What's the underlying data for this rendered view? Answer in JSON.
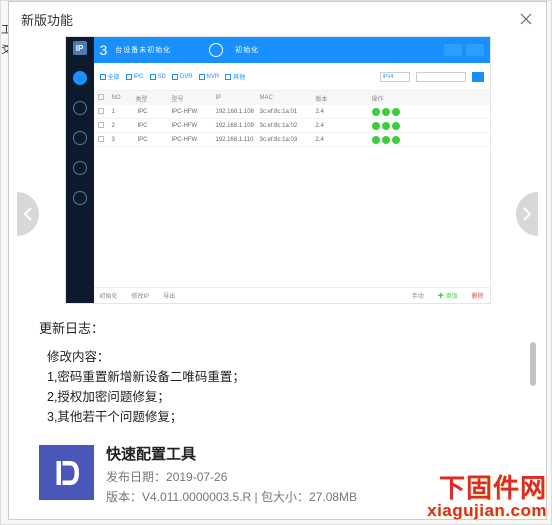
{
  "left_edge": {
    "char1": "工",
    "char2": "爻"
  },
  "header": {
    "title": "新版功能",
    "close_tooltip": "关闭"
  },
  "screenshot": {
    "big_number": "3",
    "top_text": "台设备未初始化",
    "top_link": "初始化",
    "filters": [
      "全部",
      "IPC",
      "SD",
      "DVR",
      "NVR",
      "其他"
    ],
    "dropdown": "IPV4",
    "columns": [
      "NO",
      "类型",
      "型号",
      "IP",
      "MAC",
      "版本",
      "操作"
    ],
    "rows": [
      {
        "no": "1",
        "type": "IPC",
        "model": "IPC-HFW",
        "ip": "192.168.1.108",
        "mac": "3c:ef:8c:1a:01",
        "ver": "2.4"
      },
      {
        "no": "2",
        "type": "IPC",
        "model": "IPC-HFW",
        "ip": "192.168.1.109",
        "mac": "3c:ef:8c:1a:02",
        "ver": "2.4"
      },
      {
        "no": "3",
        "type": "IPC",
        "model": "IPC-HFW",
        "ip": "192.168.1.110",
        "mac": "3c:ef:8c:1a:03",
        "ver": "2.4"
      }
    ],
    "footer_items": [
      "初始化",
      "修改IP",
      "导出",
      "手动",
      "添加",
      "删除"
    ]
  },
  "changelog": {
    "title": "更新日志：",
    "subtitle": "修改内容：",
    "items": [
      "1,密码重置新增新设备二唯码重置；",
      "2,授权加密问题修复；",
      "3,其他若干个问题修复；"
    ]
  },
  "footer": {
    "app_name": "快速配置工具",
    "date_label": "发布日期：",
    "date_value": "2019-07-26",
    "version_label": "版本：",
    "version_value": "V4.011.0000003.5.R",
    "size_label": "包大小：",
    "size_value": "27.08MB",
    "separator": " | "
  },
  "watermark": {
    "cn": "下固件网",
    "en": "xiagujian.com"
  }
}
